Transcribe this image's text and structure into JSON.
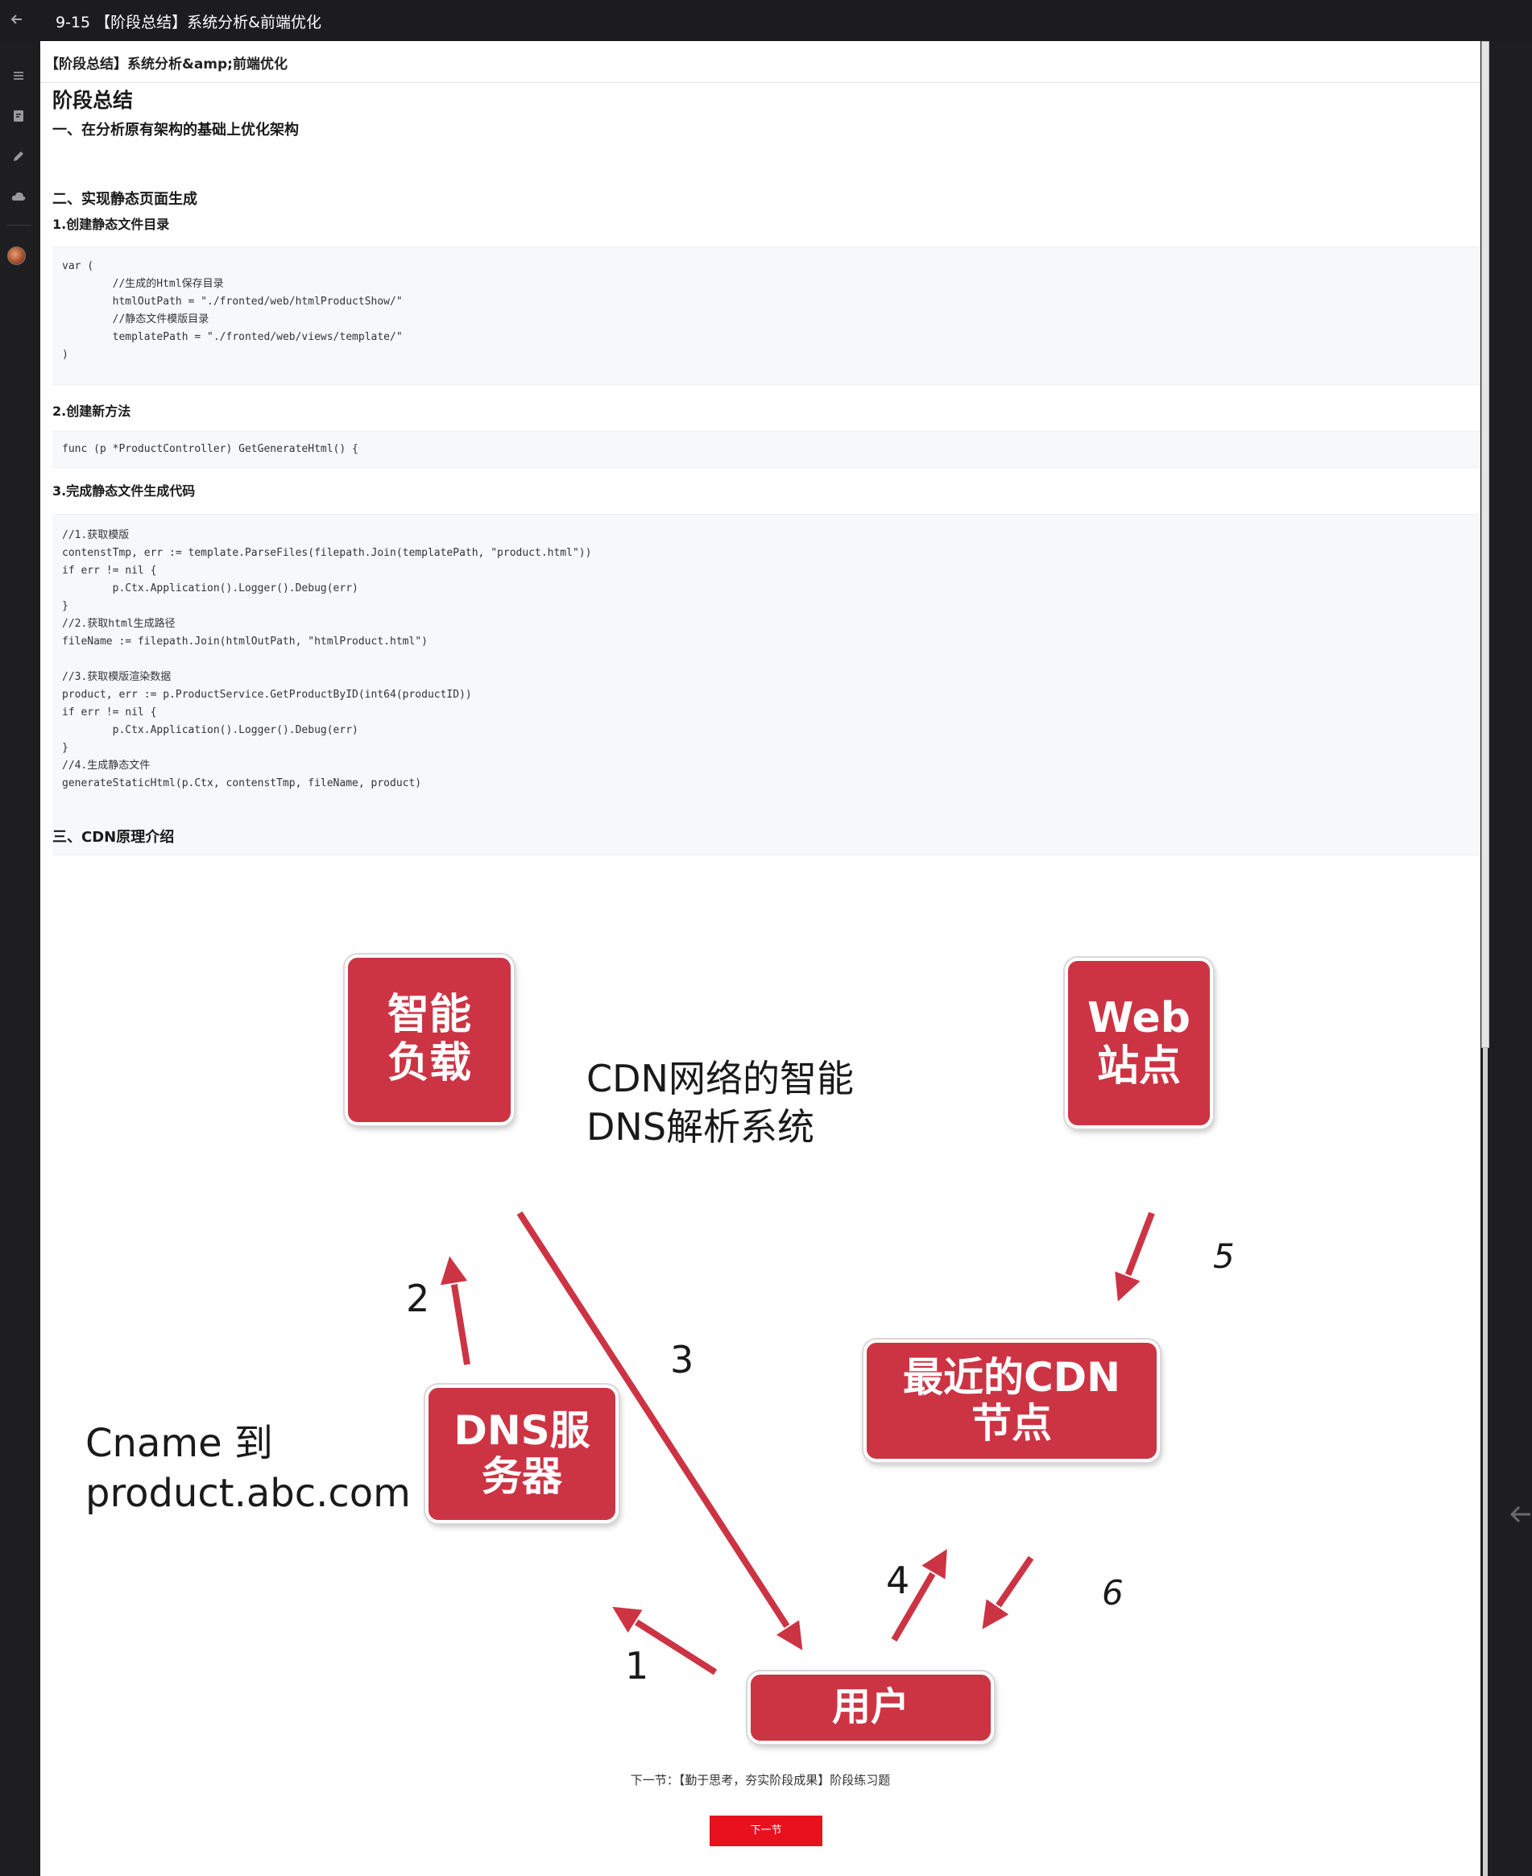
{
  "header": {
    "title": "9-15 【阶段总结】系统分析&前端优化"
  },
  "sidebar": {
    "icons": [
      "menu-icon",
      "note-icon",
      "edit-icon",
      "cloud-icon",
      "avatar"
    ]
  },
  "content": {
    "breadcrumb": "【阶段总结】系统分析&amp;前端优化",
    "page_title": "阶段总结",
    "section1_title": "一、在分析原有架构的基础上优化架构",
    "section2_title": "二、实现静态页面生成",
    "step1_title": "1.创建静态文件目录",
    "code1": "var (\n\t//生成的Html保存目录\n\thtmlOutPath = \"./fronted/web/htmlProductShow/\"\n\t//静态文件模版目录\n\ttemplatePath = \"./fronted/web/views/template/\"\n)",
    "step2_title": "2.创建新方法",
    "code2": "func (p *ProductController) GetGenerateHtml() {",
    "step3_title": "3.完成静态文件生成代码",
    "code3": "//1.获取模版\ncontenstTmp, err := template.ParseFiles(filepath.Join(templatePath, \"product.html\"))\nif err != nil {\n\tp.Ctx.Application().Logger().Debug(err)\n}\n//2.获取html生成路径\nfileName := filepath.Join(htmlOutPath, \"htmlProduct.html\")\n\n//3.获取模版渲染数据\nproduct, err := p.ProductService.GetProductByID(int64(productID))\nif err != nil {\n\tp.Ctx.Application().Logger().Debug(err)\n}\n//4.生成静态文件\ngenerateStaticHtml(p.Ctx, contenstTmp, fileName, product)",
    "section3_title": "三、CDN原理介绍"
  },
  "diagram": {
    "box_smart_lb": "智能\n负载",
    "box_web_site": "Web\n站点",
    "box_dns_server": "DNS服\n务器",
    "box_cdn_node": "最近的CDN\n节点",
    "box_user": "用户",
    "label_cdn_dns": "CDN网络的智能\nDNS解析系统",
    "label_cname": "Cname 到\nproduct.abc.com",
    "steps": [
      "1",
      "2",
      "3",
      "4",
      "5",
      "6"
    ],
    "accent_color": "#cc3444"
  },
  "footer": {
    "next_text": "下一节：【勤于思考，夯实阶段成果】阶段练习题",
    "next_button": "下一节",
    "button_color": "#e8111d"
  }
}
